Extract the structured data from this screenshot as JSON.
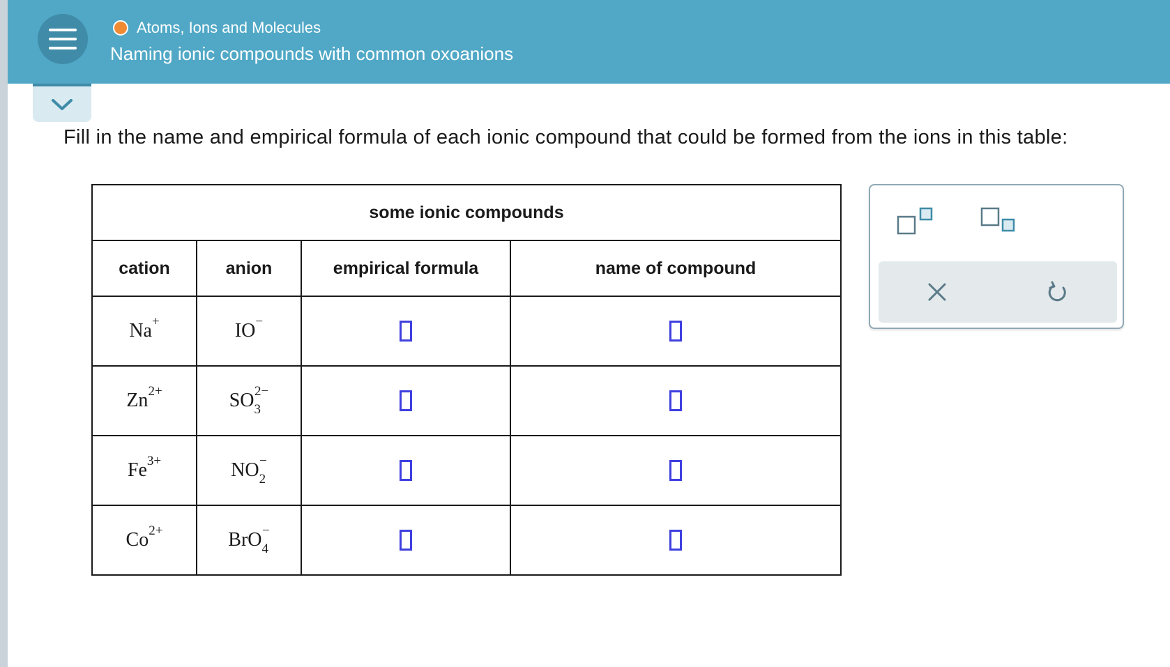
{
  "header": {
    "topic": "Atoms, Ions and Molecules",
    "title": "Naming ionic compounds with common oxoanions"
  },
  "instruction": "Fill in the name and empirical formula of each ionic compound that could be formed from the ions in this table:",
  "table": {
    "caption": "some ionic compounds",
    "headers": {
      "cation": "cation",
      "anion": "anion",
      "formula": "empirical formula",
      "name": "name of compound"
    },
    "rows": [
      {
        "cation": {
          "symbol": "Na",
          "charge": "+"
        },
        "anion": {
          "symbol": "IO",
          "sub": "",
          "charge": "−"
        }
      },
      {
        "cation": {
          "symbol": "Zn",
          "charge": "2+"
        },
        "anion": {
          "symbol": "SO",
          "sub": "3",
          "charge": "2−"
        }
      },
      {
        "cation": {
          "symbol": "Fe",
          "charge": "3+"
        },
        "anion": {
          "symbol": "NO",
          "sub": "2",
          "charge": "−"
        }
      },
      {
        "cation": {
          "symbol": "Co",
          "charge": "2+"
        },
        "anion": {
          "symbol": "BrO",
          "sub": "4",
          "charge": "−"
        }
      }
    ]
  },
  "toolbar": {
    "icons": [
      "superscript-icon",
      "subscript-icon",
      "clear-icon",
      "undo-icon"
    ]
  },
  "colors": {
    "header_bg": "#50a8c6",
    "accent": "#3f8ba8",
    "topic_dot": "#f08b33",
    "answer_box": "#3f3fe0"
  }
}
